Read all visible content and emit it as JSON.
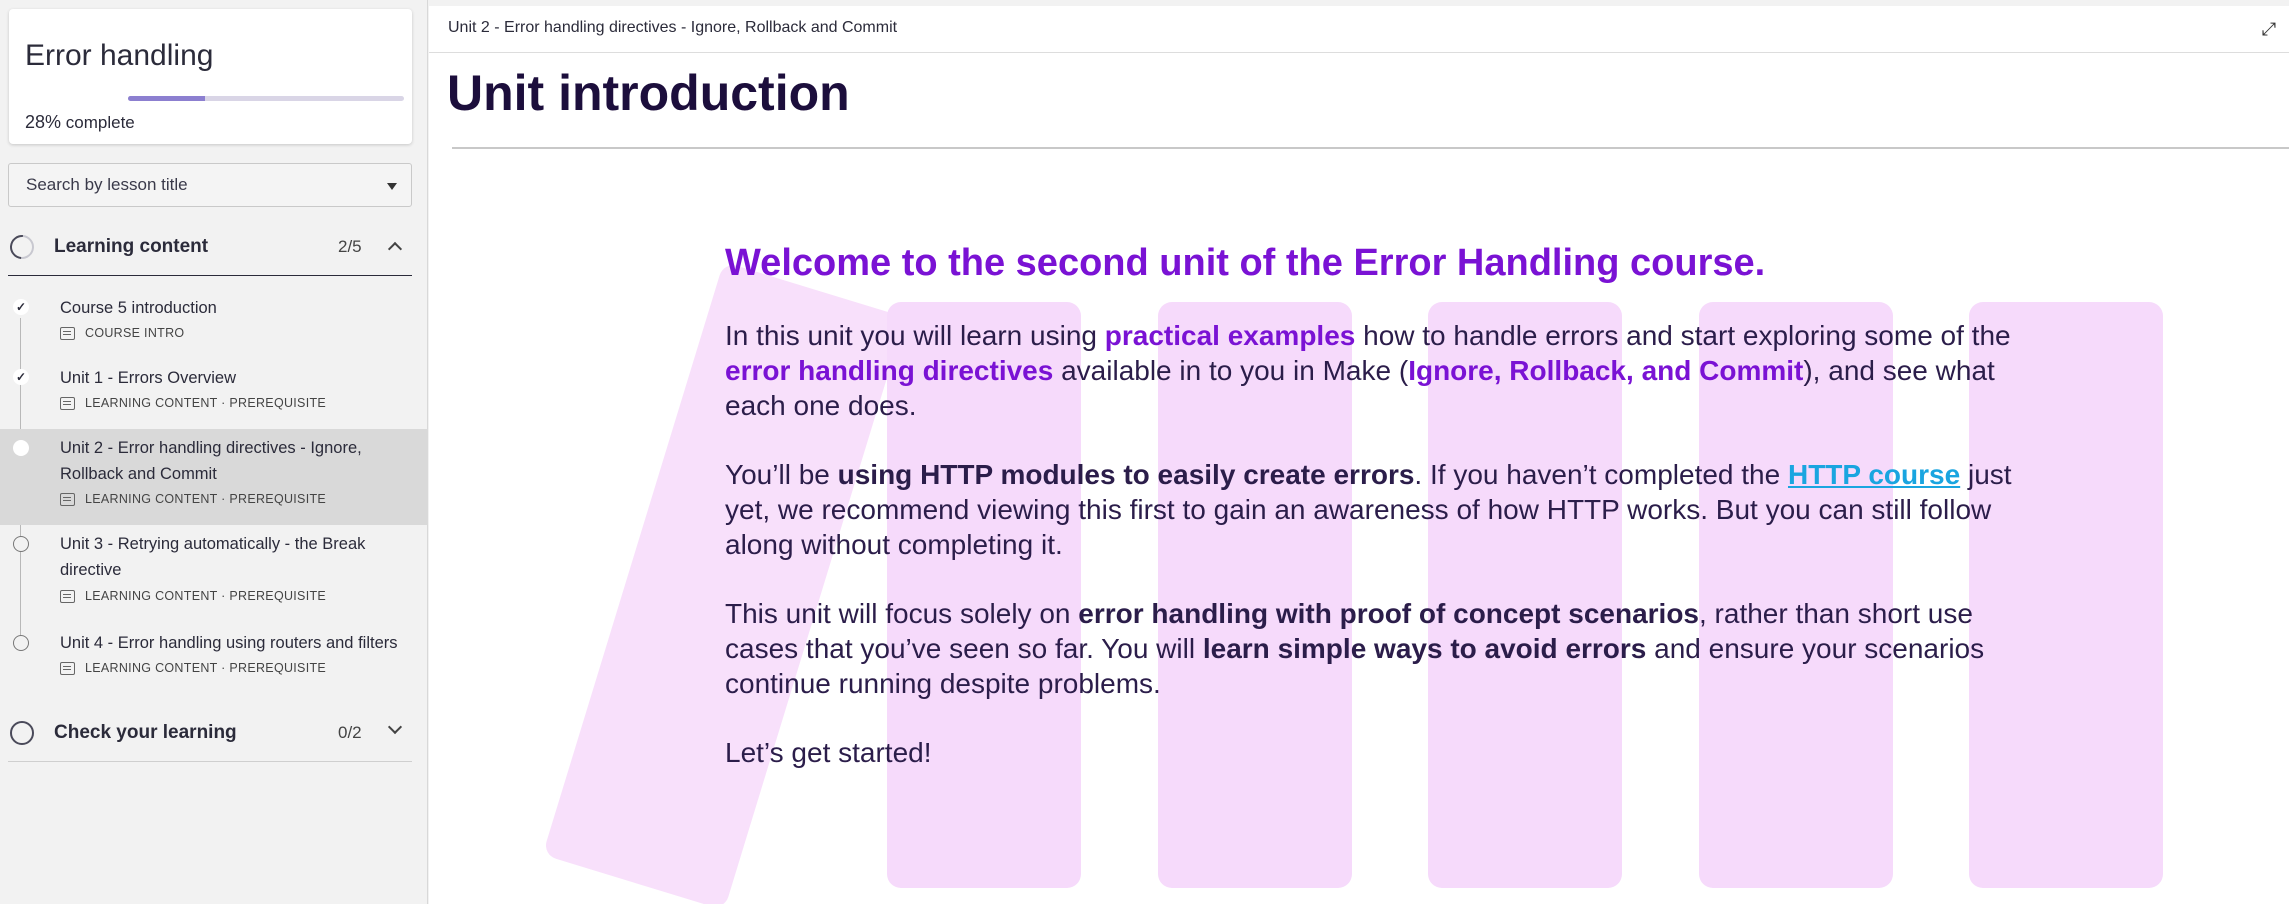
{
  "sidebar": {
    "course_title": "Error handling",
    "progress_percent": "28%",
    "progress_label": "complete",
    "progress_fraction": 0.28,
    "search_placeholder": "Search by lesson title",
    "sections": [
      {
        "title": "Learning content",
        "count": "2/5",
        "expanded": true,
        "lessons": [
          {
            "title": "Course 5 introduction",
            "meta": "COURSE INTRO",
            "status": "done"
          },
          {
            "title": "Unit 1 - Errors Overview",
            "meta": "LEARNING CONTENT · PREREQUISITE",
            "status": "done"
          },
          {
            "title": "Unit 2 - Error handling directives - Ignore, Rollback and Commit",
            "meta": "LEARNING CONTENT · PREREQUISITE",
            "status": "active"
          },
          {
            "title": "Unit 3 - Retrying automatically - the Break directive",
            "meta": "LEARNING CONTENT · PREREQUISITE",
            "status": "todo"
          },
          {
            "title": "Unit 4 - Error handling using routers and filters",
            "meta": "LEARNING CONTENT · PREREQUISITE",
            "status": "todo"
          }
        ]
      },
      {
        "title": "Check your learning",
        "count": "0/2",
        "expanded": false
      }
    ]
  },
  "main": {
    "breadcrumb": "Unit 2 - Error handling directives - Ignore, Rollback and Commit",
    "title": "Unit introduction",
    "content": {
      "heading": "Welcome to the second unit of the Error Handling course.",
      "p1": {
        "t1": "In this unit you will learn using ",
        "h1": "practical examples",
        "t2": " how to handle errors and start exploring some of the ",
        "h2": "error handling directives",
        "t3": " available in to you in Make (",
        "h3": "Ignore, Rollback, and Commit",
        "t4": "), and see what each one does."
      },
      "p2": {
        "t1": "You’ll be ",
        "b1": "using HTTP modules to easily create errors",
        "t2": ". If you haven’t completed the ",
        "link": "HTTP course",
        "t3": " just yet, we recommend viewing this first to gain an awareness of how HTTP works. But you can still follow along without completing it."
      },
      "p3": {
        "t1": "This unit will focus solely on ",
        "b1": "error handling with proof of concept scenarios",
        "t2": ", rather than short use cases that you’ve seen so far. You will ",
        "b2": "learn simple ways to avoid errors",
        "t3": " and ensure your scenarios continue running despite problems."
      },
      "p4": "Let’s get started!"
    }
  },
  "icons": {
    "expand": "expand-icon",
    "check": "check-icon",
    "module": "module-icon",
    "dropdown": "caret-down-icon"
  },
  "colors": {
    "accent_purple": "#7a12d4",
    "link_blue": "#1aa5e0",
    "title_dark": "#1c0e3c",
    "hero_pink": "#f6dafb"
  }
}
